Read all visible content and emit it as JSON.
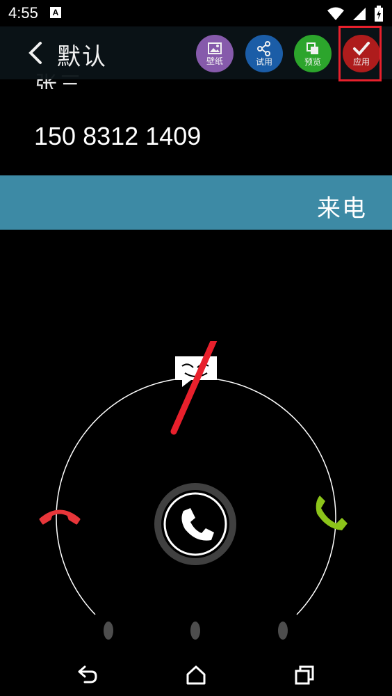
{
  "status": {
    "time": "4:55",
    "app_badge": "A"
  },
  "toolbar": {
    "title": "默认",
    "actions": [
      {
        "label": "壁纸",
        "icon": "image-icon",
        "color": "#8e5fb5"
      },
      {
        "label": "试用",
        "icon": "share-icon",
        "color": "#1d63b0"
      },
      {
        "label": "预览",
        "icon": "preview-icon",
        "color": "#2fae2f"
      },
      {
        "label": "应用",
        "icon": "check-icon",
        "color": "#b81e1e"
      }
    ]
  },
  "contact": {
    "name": "张三",
    "number": "150 8312 1409"
  },
  "banner": {
    "label": "来电"
  },
  "colors": {
    "decline": "#e8363a",
    "answer": "#8cc41a",
    "banner": "#3d8aa5",
    "annotation": "#e8202c"
  }
}
